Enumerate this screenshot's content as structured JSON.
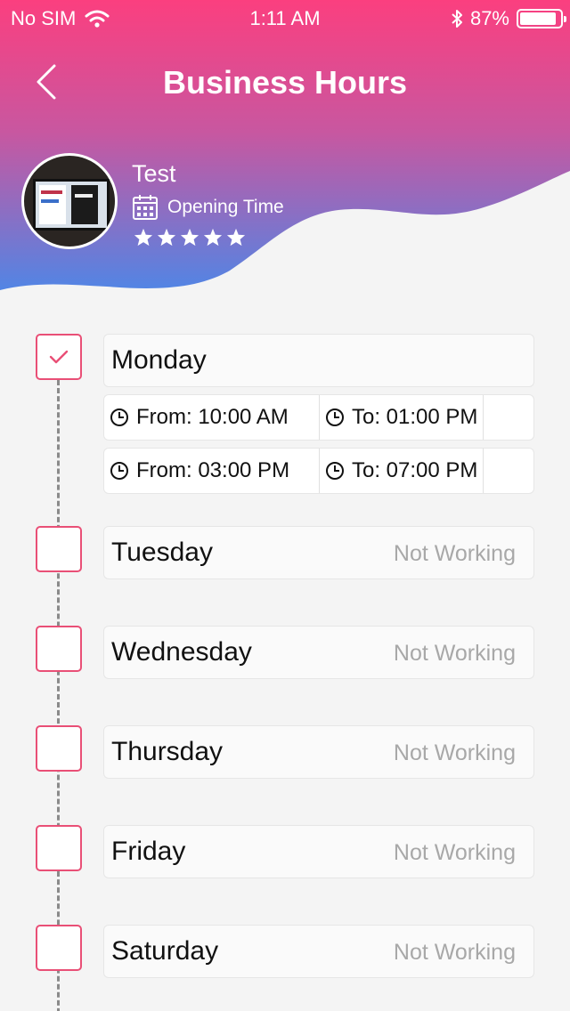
{
  "status_bar": {
    "carrier": "No SIM",
    "time": "1:11 AM",
    "battery": "87%"
  },
  "nav": {
    "title": "Business Hours"
  },
  "profile": {
    "name": "Test",
    "subtitle": "Opening Time",
    "rating": 5
  },
  "days": [
    {
      "name": "Monday",
      "checked": true,
      "status": "",
      "slots": [
        {
          "from": "From: 10:00 AM",
          "to": "To: 01:00 PM"
        },
        {
          "from": "From: 03:00 PM",
          "to": "To: 07:00 PM"
        }
      ]
    },
    {
      "name": "Tuesday",
      "checked": false,
      "status": "Not Working"
    },
    {
      "name": "Wednesday",
      "checked": false,
      "status": "Not Working"
    },
    {
      "name": "Thursday",
      "checked": false,
      "status": "Not Working"
    },
    {
      "name": "Friday",
      "checked": false,
      "status": "Not Working"
    },
    {
      "name": "Saturday",
      "checked": false,
      "status": "Not Working"
    }
  ],
  "colors": {
    "header_top": "#fb3f7f",
    "header_mid": "#c857a0",
    "header_bottom": "#4f86e6",
    "accent": "#e94f76",
    "background": "#f4f4f4"
  }
}
